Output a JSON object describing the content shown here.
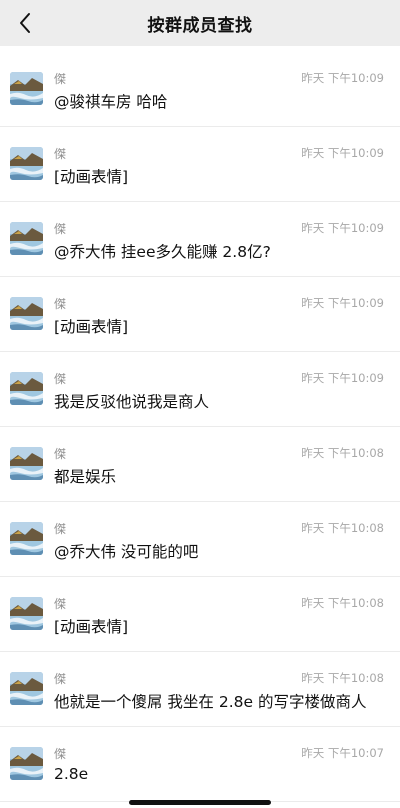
{
  "header": {
    "title": "按群成员查找",
    "back_icon": "chevron-left-icon"
  },
  "messages": [
    {
      "sender": "傑",
      "time": "昨天 下午10:09",
      "text": "@骏祺车房 哈哈"
    },
    {
      "sender": "傑",
      "time": "昨天 下午10:09",
      "text": "[动画表情]"
    },
    {
      "sender": "傑",
      "time": "昨天 下午10:09",
      "text": "@乔大伟 挂ee多久能赚 2.8亿?"
    },
    {
      "sender": "傑",
      "time": "昨天 下午10:09",
      "text": "[动画表情]"
    },
    {
      "sender": "傑",
      "time": "昨天 下午10:09",
      "text": "我是反驳他说我是商人"
    },
    {
      "sender": "傑",
      "time": "昨天 下午10:08",
      "text": "都是娱乐"
    },
    {
      "sender": "傑",
      "time": "昨天 下午10:08",
      "text": "@乔大伟 没可能的吧"
    },
    {
      "sender": "傑",
      "time": "昨天 下午10:08",
      "text": "[动画表情]"
    },
    {
      "sender": "傑",
      "time": "昨天 下午10:08",
      "text": "他就是一个傻屌 我坐在 2.8e 的写字楼做商人"
    },
    {
      "sender": "傑",
      "time": "昨天 下午10:07",
      "text": "2.8e"
    }
  ]
}
